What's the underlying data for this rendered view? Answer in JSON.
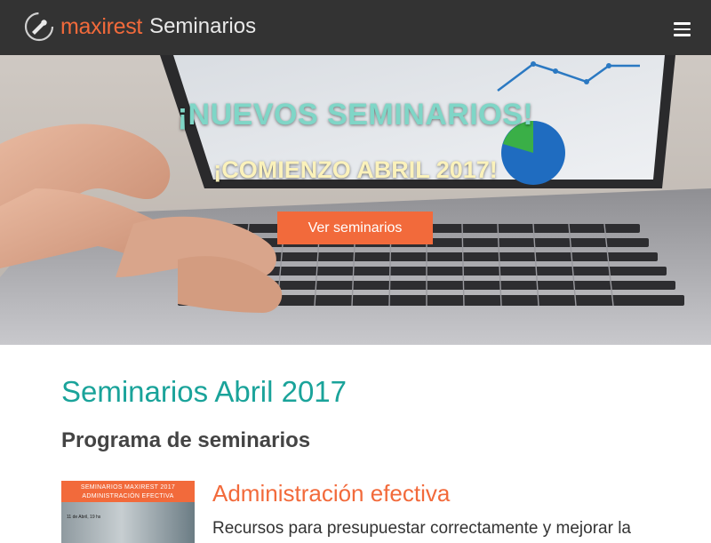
{
  "navbar": {
    "brand_name": "maxirest",
    "brand_sub": "Seminarios",
    "logo_icon": "chef-hat-icon",
    "menu_icon": "hamburger-menu-icon"
  },
  "hero": {
    "title": "¡NUEVOS SEMINARIOS!",
    "subtitle": "¡COMIENZO ABRIL 2017!",
    "button_label": "Ver seminarios"
  },
  "main": {
    "section_title": "Seminarios Abril 2017",
    "section_subtitle": "Programa de seminarios",
    "seminars": [
      {
        "thumb_line1": "SEMINARIOS MAXIREST 2017",
        "thumb_line2": "ADMINISTRACIÓN EFECTIVA",
        "thumb_date": "11 de Abril, 19 hs",
        "title": "Administración efectiva",
        "description": "Recursos para presupuestar correctamente y mejorar la"
      }
    ]
  },
  "colors": {
    "navbar_bg": "#333333",
    "brand_orange": "#f26a3b",
    "hero_title": "#7fd6c7",
    "hero_subtitle": "#fbf2bb",
    "section_title": "#1aa39a"
  }
}
